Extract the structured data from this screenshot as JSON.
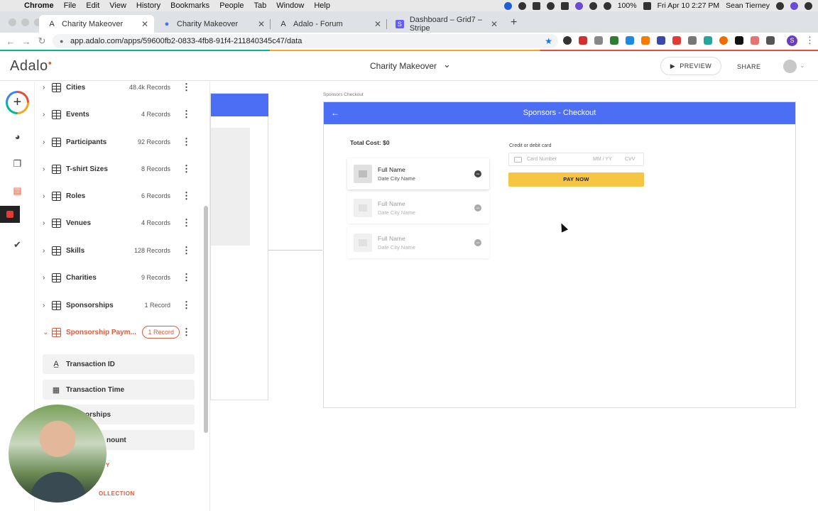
{
  "menubar": {
    "items": [
      "Chrome",
      "File",
      "Edit",
      "View",
      "History",
      "Bookmarks",
      "People",
      "Tab",
      "Window",
      "Help"
    ],
    "battery": "100%",
    "datetime": "Fri Apr 10  2:27 PM",
    "user": "Sean Tierney"
  },
  "browser": {
    "tabs": [
      {
        "title": "Charity Makeover",
        "active": true
      },
      {
        "title": "Charity Makeover",
        "active": false
      },
      {
        "title": "Adalo - Forum",
        "active": false
      },
      {
        "title": "Dashboard – Grid7 – Stripe",
        "active": false
      }
    ],
    "url": "app.adalo.com/apps/59600fb2-0833-4fb8-91f4-211840345c47/data",
    "profile_initial": "S"
  },
  "header": {
    "logo": "Adalo",
    "app_title": "Charity Makeover",
    "preview_label": "PREVIEW",
    "share_label": "SHARE"
  },
  "collections": [
    {
      "name": "Cities",
      "count": "48.4k Records"
    },
    {
      "name": "Events",
      "count": "4 Records"
    },
    {
      "name": "Participants",
      "count": "92 Records"
    },
    {
      "name": "T-shirt Sizes",
      "count": "8 Records"
    },
    {
      "name": "Roles",
      "count": "6 Records"
    },
    {
      "name": "Venues",
      "count": "4 Records"
    },
    {
      "name": "Skills",
      "count": "128 Records"
    },
    {
      "name": "Charities",
      "count": "9 Records"
    },
    {
      "name": "Sponsorships",
      "count": "1 Record"
    },
    {
      "name": "Sponsorship Paym...",
      "count": "1 Record",
      "selected": true
    }
  ],
  "properties": [
    {
      "label": "Transaction ID",
      "icon": "text-icon"
    },
    {
      "label": "Transaction Time",
      "icon": "calendar-icon"
    },
    {
      "label": "orships",
      "icon": "relationship-icon"
    },
    {
      "label": "nount",
      "icon": "number-icon"
    }
  ],
  "panel_footer": {
    "add_property": "Y",
    "add_collection": "OLLECTION"
  },
  "canvas": {
    "screen_label": "Sponsors Checkout",
    "screen_title": "Sponsors - Checkout",
    "total_cost": "Total Cost: $0",
    "list_items": [
      {
        "title": "Full Name",
        "subtitle": "Date City Name"
      },
      {
        "title": "Full Name",
        "subtitle": "Date City Name"
      },
      {
        "title": "Full Name",
        "subtitle": "Date City Name"
      }
    ],
    "card_label": "Credit or debit card",
    "card_number_placeholder": "Card Number",
    "expiry_placeholder": "MM / YY",
    "cvv_placeholder": "CVV",
    "pay_button": "PAY NOW"
  },
  "colors": {
    "accent": "#e05a3d",
    "appbar": "#4c6ef5",
    "pay_button": "#f6c543"
  }
}
